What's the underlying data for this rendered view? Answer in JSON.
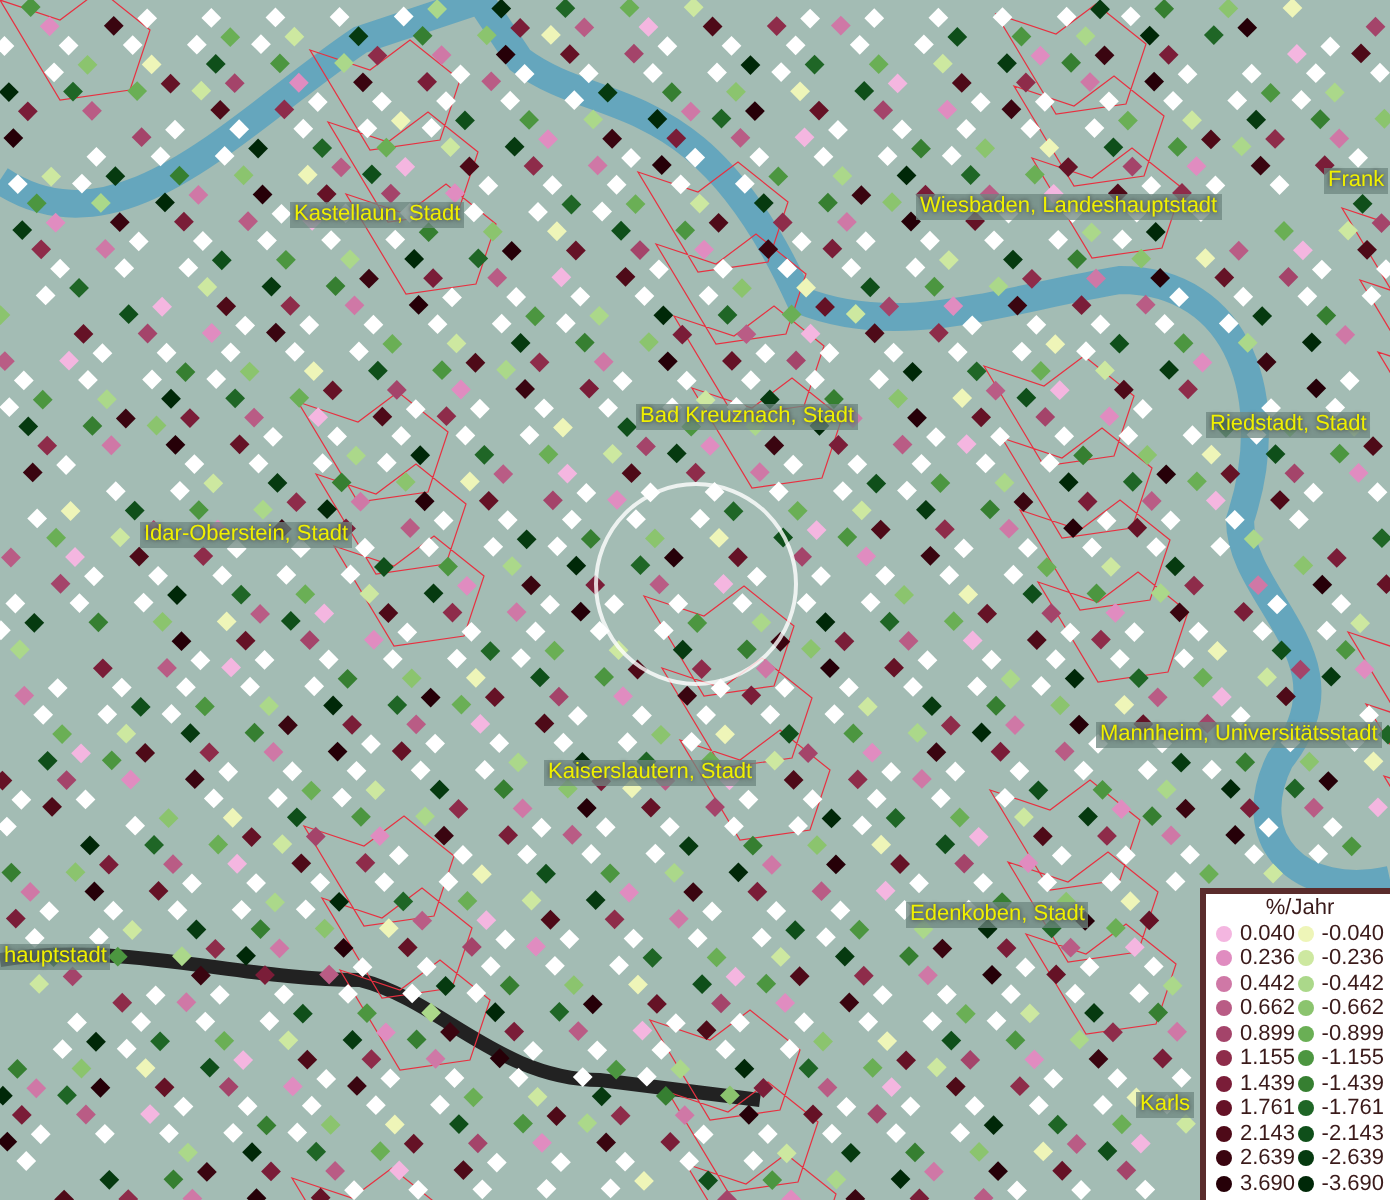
{
  "map": {
    "place_labels": [
      {
        "text": "Kastellaun, Stadt"
      },
      {
        "text": "Wiesbaden, Landeshauptstadt"
      },
      {
        "text": "Frank"
      },
      {
        "text": "Bad Kreuznach, Stadt"
      },
      {
        "text": "Riedstadt, Stadt"
      },
      {
        "text": "Idar-Oberstein, Stadt"
      },
      {
        "text": "Kaiserslautern, Stadt"
      },
      {
        "text": "Mannheim, Universitätsstadt"
      },
      {
        "text": "Edenkoben, Stadt"
      },
      {
        "text": "hauptstadt"
      },
      {
        "text": "Karls"
      }
    ]
  },
  "legend": {
    "title": "%/Jahr",
    "rows": [
      {
        "positive": {
          "label": "0.040",
          "color": "#f4b6e0"
        },
        "negative": {
          "label": "-0.040",
          "color": "#eef5b8"
        }
      },
      {
        "positive": {
          "label": "0.236",
          "color": "#e08cc0"
        },
        "negative": {
          "label": "-0.236",
          "color": "#cde8a0"
        }
      },
      {
        "positive": {
          "label": "0.442",
          "color": "#cf78a6"
        },
        "negative": {
          "label": "-0.442",
          "color": "#abd88a"
        }
      },
      {
        "positive": {
          "label": "0.662",
          "color": "#b95c85"
        },
        "negative": {
          "label": "-0.662",
          "color": "#8bc46e"
        }
      },
      {
        "positive": {
          "label": "0.899",
          "color": "#a4446a"
        },
        "negative": {
          "label": "-0.899",
          "color": "#6aaf55"
        }
      },
      {
        "positive": {
          "label": "1.155",
          "color": "#8e2c4a"
        },
        "negative": {
          "label": "-1.155",
          "color": "#4c9640"
        }
      },
      {
        "positive": {
          "label": "1.439",
          "color": "#7a1d38"
        },
        "negative": {
          "label": "-1.439",
          "color": "#367f31"
        }
      },
      {
        "positive": {
          "label": "1.761",
          "color": "#651226"
        },
        "negative": {
          "label": "-1.761",
          "color": "#1f6626"
        }
      },
      {
        "positive": {
          "label": "2.143",
          "color": "#4e0a18"
        },
        "negative": {
          "label": "-2.143",
          "color": "#0f4f1a"
        }
      },
      {
        "positive": {
          "label": "2.639",
          "color": "#3a0510"
        },
        "negative": {
          "label": "-2.639",
          "color": "#063a10"
        }
      },
      {
        "positive": {
          "label": "3.690",
          "color": "#260008"
        },
        "negative": {
          "label": "-3.690",
          "color": "#002808"
        }
      }
    ]
  }
}
